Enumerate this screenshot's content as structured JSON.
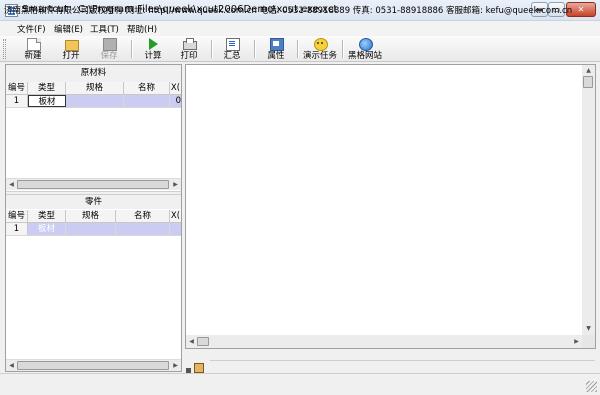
{
  "window": {
    "title": "Smartcut - C:\\Program Files\\queek\\xcut2006Demo\\xcut.exe.xct",
    "controls": {
      "minimize": "▬",
      "maximize": "▭",
      "close": "✕"
    }
  },
  "menu": [
    {
      "label": "文件(F)"
    },
    {
      "label": "编辑(E)"
    },
    {
      "label": "工具(T)"
    },
    {
      "label": "帮助(H)"
    }
  ],
  "toolbar": {
    "buttons": [
      {
        "label": "新建",
        "icon": "new-file-icon",
        "enabled": true
      },
      {
        "label": "打开",
        "icon": "open-folder-icon",
        "enabled": true
      },
      {
        "label": "保存",
        "icon": "save-icon",
        "enabled": false
      },
      {
        "label": "计算",
        "icon": "play-calculate-icon",
        "enabled": true
      },
      {
        "label": "打印",
        "icon": "printer-icon",
        "enabled": true
      },
      {
        "label": "汇总",
        "icon": "summary-icon",
        "enabled": true
      },
      {
        "label": "属性",
        "icon": "properties-icon",
        "enabled": true
      },
      {
        "label": "演示任务",
        "icon": "smiley-demo-icon",
        "enabled": true
      },
      {
        "label": "黑格网站",
        "icon": "internet-explorer-icon",
        "enabled": true
      }
    ]
  },
  "materials": {
    "caption": "原材料",
    "columns": [
      "编号",
      "类型",
      "规格",
      "名称",
      "X("
    ],
    "rows": [
      {
        "num": "1",
        "type": "板材",
        "spec": "",
        "name": "",
        "x": "0"
      }
    ]
  },
  "parts": {
    "caption": "零件",
    "columns": [
      "编号",
      "类型",
      "规格",
      "名称",
      "X("
    ],
    "rows": [
      {
        "num": "1",
        "type": "板材",
        "spec": "",
        "name": "",
        "x": ""
      }
    ]
  },
  "scroll_arrows": {
    "left": "◀",
    "right": "▶",
    "up": "▲",
    "down": "▼"
  },
  "status_bar": {
    "text": "济南黑格软件有限公司版权所有 网址: http://www.queek.com.cn  电话: 0531-88918889 传真: 0531-88918886 客服邮箱: kefu@queek.com.cn"
  },
  "colors": {
    "selection": "#ccccf2",
    "title_bar": "#dbe5f1",
    "calc_green": "#23a023"
  }
}
